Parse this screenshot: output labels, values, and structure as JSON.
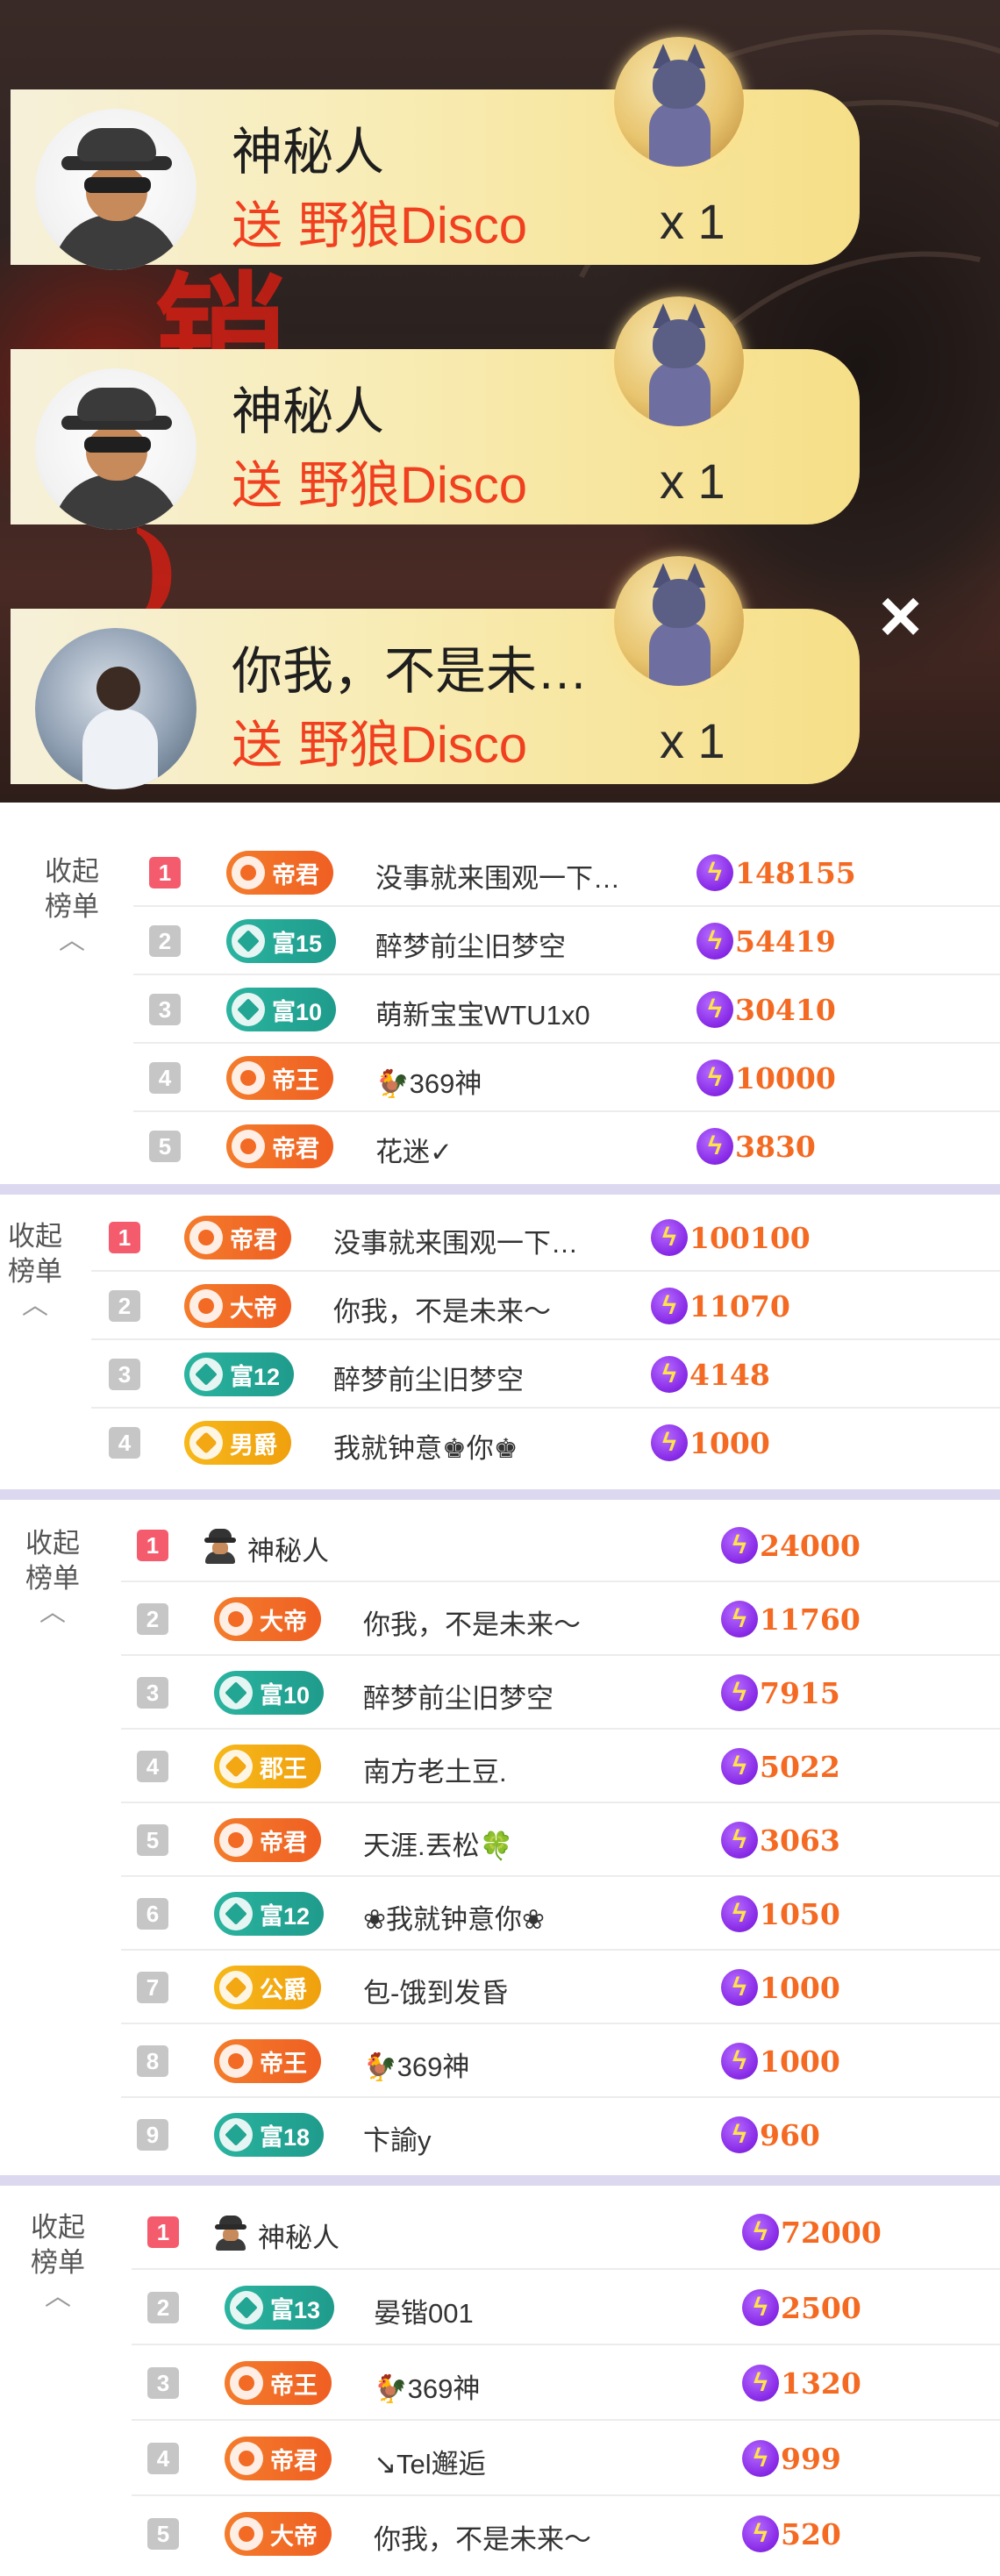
{
  "gift_popups": [
    {
      "name": "神秘人",
      "send_label": "送",
      "gift": "野狼Disco",
      "count": "x 1",
      "avatar": "spy-avatar"
    },
    {
      "name": "神秘人",
      "send_label": "送",
      "gift": "野狼Disco",
      "count": "x 1",
      "avatar": "spy-avatar"
    },
    {
      "name": "你我，不是未…",
      "send_label": "送",
      "gift": "野狼Disco",
      "count": "x 1",
      "avatar": "photo-avatar"
    }
  ],
  "close_icon": "×",
  "collapse_label": "收起\n榜单",
  "collapse_chevron": "︿",
  "rank_panels": [
    {
      "rows": [
        {
          "rank": "1",
          "badge": "帝君",
          "badge_color": "#f26a24",
          "name": "没事就来围观一下…",
          "value": "148155"
        },
        {
          "rank": "2",
          "badge": "富15",
          "badge_color": "#22a592",
          "name": "醉梦前尘旧梦空",
          "value": "54419"
        },
        {
          "rank": "3",
          "badge": "富10",
          "badge_color": "#22a592",
          "name": "萌新宝宝WTU1x0",
          "value": "30410"
        },
        {
          "rank": "4",
          "badge": "帝王",
          "badge_color": "#f26a24",
          "name": "🐓369神",
          "value": "10000"
        },
        {
          "rank": "5",
          "badge": "帝君",
          "badge_color": "#f26a24",
          "name": "花迷✓",
          "value": "3830"
        }
      ]
    },
    {
      "rows": [
        {
          "rank": "1",
          "badge": "帝君",
          "badge_color": "#f26a24",
          "name": "没事就来围观一下…",
          "value": "100100"
        },
        {
          "rank": "2",
          "badge": "大帝",
          "badge_color": "#f26a24",
          "name": "你我，不是未来～",
          "value": "11070"
        },
        {
          "rank": "3",
          "badge": "富12",
          "badge_color": "#22a592",
          "name": "醉梦前尘旧梦空",
          "value": "4148"
        },
        {
          "rank": "4",
          "badge": "男爵",
          "badge_color": "#f2a713",
          "name": "我就钟意♚你♚",
          "value": "1000"
        }
      ]
    },
    {
      "rows": [
        {
          "rank": "1",
          "badge": "",
          "badge_color": "",
          "name": "神秘人",
          "value": "24000"
        },
        {
          "rank": "2",
          "badge": "大帝",
          "badge_color": "#f26a24",
          "name": "你我，不是未来～",
          "value": "11760"
        },
        {
          "rank": "3",
          "badge": "富10",
          "badge_color": "#22a592",
          "name": "醉梦前尘旧梦空",
          "value": "7915"
        },
        {
          "rank": "4",
          "badge": "郡王",
          "badge_color": "#f2a713",
          "name": "南方老土豆.",
          "value": "5022"
        },
        {
          "rank": "5",
          "badge": "帝君",
          "badge_color": "#f26a24",
          "name": "天涯.丟松🍀",
          "value": "3063"
        },
        {
          "rank": "6",
          "badge": "富12",
          "badge_color": "#22a592",
          "name": "❀我就钟意你❀",
          "value": "1050"
        },
        {
          "rank": "7",
          "badge": "公爵",
          "badge_color": "#f2a713",
          "name": "包-饿到发昏",
          "value": "1000"
        },
        {
          "rank": "8",
          "badge": "帝王",
          "badge_color": "#f26a24",
          "name": "🐓369神",
          "value": "1000"
        },
        {
          "rank": "9",
          "badge": "富18",
          "badge_color": "#22a592",
          "name": "卞諭y",
          "value": "960"
        }
      ]
    },
    {
      "rows": [
        {
          "rank": "1",
          "badge": "",
          "badge_color": "",
          "name": "神秘人",
          "value": "72000"
        },
        {
          "rank": "2",
          "badge": "富13",
          "badge_color": "#22a592",
          "name": "晏锴001",
          "value": "2500"
        },
        {
          "rank": "3",
          "badge": "帝王",
          "badge_color": "#f26a24",
          "name": "🐓369神",
          "value": "1320"
        },
        {
          "rank": "4",
          "badge": "帝君",
          "badge_color": "#f26a24",
          "name": "↘Tel邂逅",
          "value": "999"
        },
        {
          "rank": "5",
          "badge": "大帝",
          "badge_color": "#f26a24",
          "name": "你我，不是未来～",
          "value": "520"
        }
      ]
    }
  ]
}
